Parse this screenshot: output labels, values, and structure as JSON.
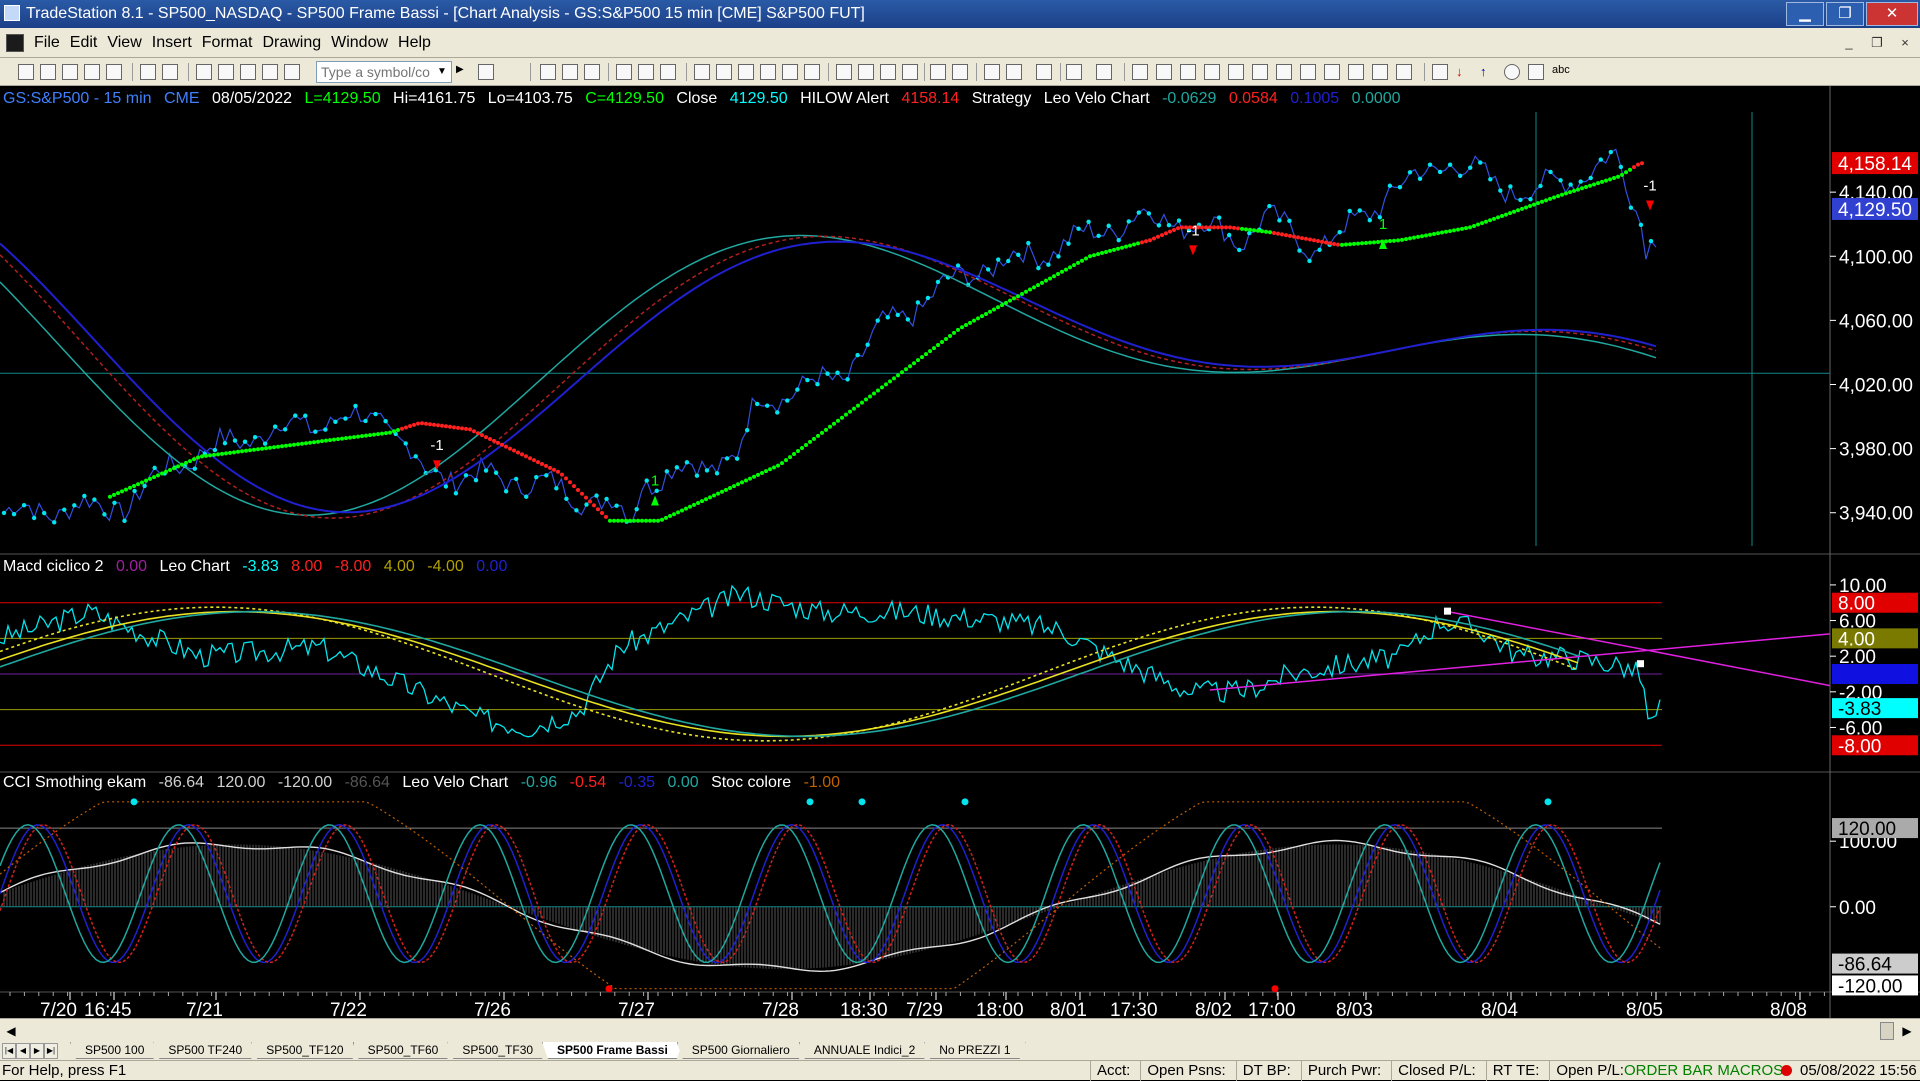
{
  "window": {
    "title": "TradeStation 8.1 - SP500_NASDAQ - SP500 Frame Bassi - [Chart Analysis - GS:S&P500  15 min  [CME] S&P500 FUT]",
    "minimize": "▁",
    "maximize": "❐",
    "close": "✕"
  },
  "menu": {
    "items": [
      "File",
      "Edit",
      "View",
      "Insert",
      "Format",
      "Drawing",
      "Window",
      "Help"
    ],
    "mdi_minimize": "_",
    "mdi_restore": "❐",
    "mdi_close": "×"
  },
  "toolbar": {
    "symbol_placeholder": "Type a symbol/co",
    "dropdown_glyph": "▼",
    "draw_text_label": "abc"
  },
  "colors": {
    "background": "#000000",
    "price": "#00e5ee",
    "bull": "#00ff00",
    "bear": "#ff2020",
    "blue": "#2020d0",
    "teal": "#20a8a0",
    "yellow": "#e8e020",
    "magenta": "#e020e0",
    "axis_text": "#ffffff"
  },
  "price_panel": {
    "header": {
      "symbol": "GS:S&P500 - 15 min",
      "exchange": "CME",
      "date": "08/05/2022",
      "last": "L=4129.50",
      "high": "Hi=4161.75",
      "low": "Lo=4103.75",
      "close": "C=4129.50",
      "close_label": "Close",
      "close_value": "4129.50",
      "hilow_label": "HILOW Alert",
      "hilow_value": "4158.14",
      "strategy_label": "Strategy",
      "leo_label": "Leo Velo Chart",
      "leo_v1": "-0.0629",
      "leo_v2": "0.0584",
      "leo_v3": "0.1005",
      "leo_v4": "0.0000"
    },
    "axis_labels": [
      "4,140.00",
      "4,100.00",
      "4,060.00",
      "4,020.00",
      "3,980.00",
      "3,940.00"
    ],
    "axis_values": [
      4140,
      4100,
      4060,
      4020,
      3980,
      3940
    ],
    "tags": {
      "hilow": "4,158.14",
      "last": "4,129.50"
    },
    "markers": [
      "-1",
      "1",
      "-1",
      "1",
      "-1"
    ],
    "ylim": [
      3913,
      4190
    ]
  },
  "macd_panel": {
    "header": {
      "name": "Macd ciclico 2",
      "v0": "0.00",
      "leo": "Leo Chart",
      "v1": "-3.83",
      "v2": "8.00",
      "v3": "-8.00",
      "v4": "4.00",
      "v5": "-4.00",
      "v6": "0.00"
    },
    "axis_labels": [
      "10.00",
      "6.00",
      "2.00",
      "-2.00",
      "-6.00"
    ],
    "axis_values": [
      10,
      6,
      2,
      -2,
      -6
    ],
    "tags": [
      {
        "text": "8.00",
        "value": 8,
        "bg": "#e00000",
        "fg": "#ffffff"
      },
      {
        "text": "4.00",
        "value": 4,
        "bg": "#7a7a00",
        "fg": "#ffffff"
      },
      {
        "text": "0.00",
        "value": 0,
        "bg": "#1010e0",
        "fg": "#1010e0"
      },
      {
        "text": "-3.83",
        "value": -3.83,
        "bg": "#00ffff",
        "fg": "#000000"
      },
      {
        "text": "-8.00",
        "value": -8,
        "bg": "#e00000",
        "fg": "#ffffff"
      }
    ],
    "ylim": [
      -11,
      11
    ]
  },
  "cci_panel": {
    "header": {
      "name": "CCI Smothing ekam",
      "v1": "-86.64",
      "v2": "120.00",
      "v3": "-120.00",
      "v4": "-86.64",
      "leo": "Leo Velo Chart",
      "l1": "-0.96",
      "l2": "-0.54",
      "l3": "-0.35",
      "l4": "0.00",
      "stoc": "Stoc colore",
      "stoc_v": "-1.00"
    },
    "axis_labels": [
      "100.00",
      "0.00"
    ],
    "axis_values": [
      100,
      0
    ],
    "tags": {
      "top": "120.00",
      "cur": "-86.64",
      "bottom": "-120.00"
    },
    "ylim": [
      -130,
      175
    ]
  },
  "time_axis": {
    "labels": [
      "7/20",
      "16:45",
      "7/21",
      "7/22",
      "7/26",
      "7/27",
      "7/28",
      "18:30",
      "7/29",
      "18:00",
      "8/01",
      "17:30",
      "8/02",
      "17:00",
      "8/03",
      "8/04",
      "8/05",
      "8/08"
    ]
  },
  "tabs": [
    "SP500 100",
    "SP500 TF240",
    "SP500_TF120",
    "SP500_TF60",
    "SP500_TF30",
    "SP500 Frame Bassi",
    "SP500 Giornaliero",
    "ANNUALE Indici_2",
    "No PREZZI 1"
  ],
  "active_tab": "SP500 Frame Bassi",
  "status": {
    "help": "For Help, press F1",
    "fields": [
      "Acct:",
      "Open Psns:",
      "DT BP:",
      "Purch Pwr:",
      "Closed P/L:",
      "RT TE:",
      "Open P/L:"
    ],
    "order_bar": "ORDER BAR  MACROS",
    "clock": "05/08/2022 15:56"
  }
}
